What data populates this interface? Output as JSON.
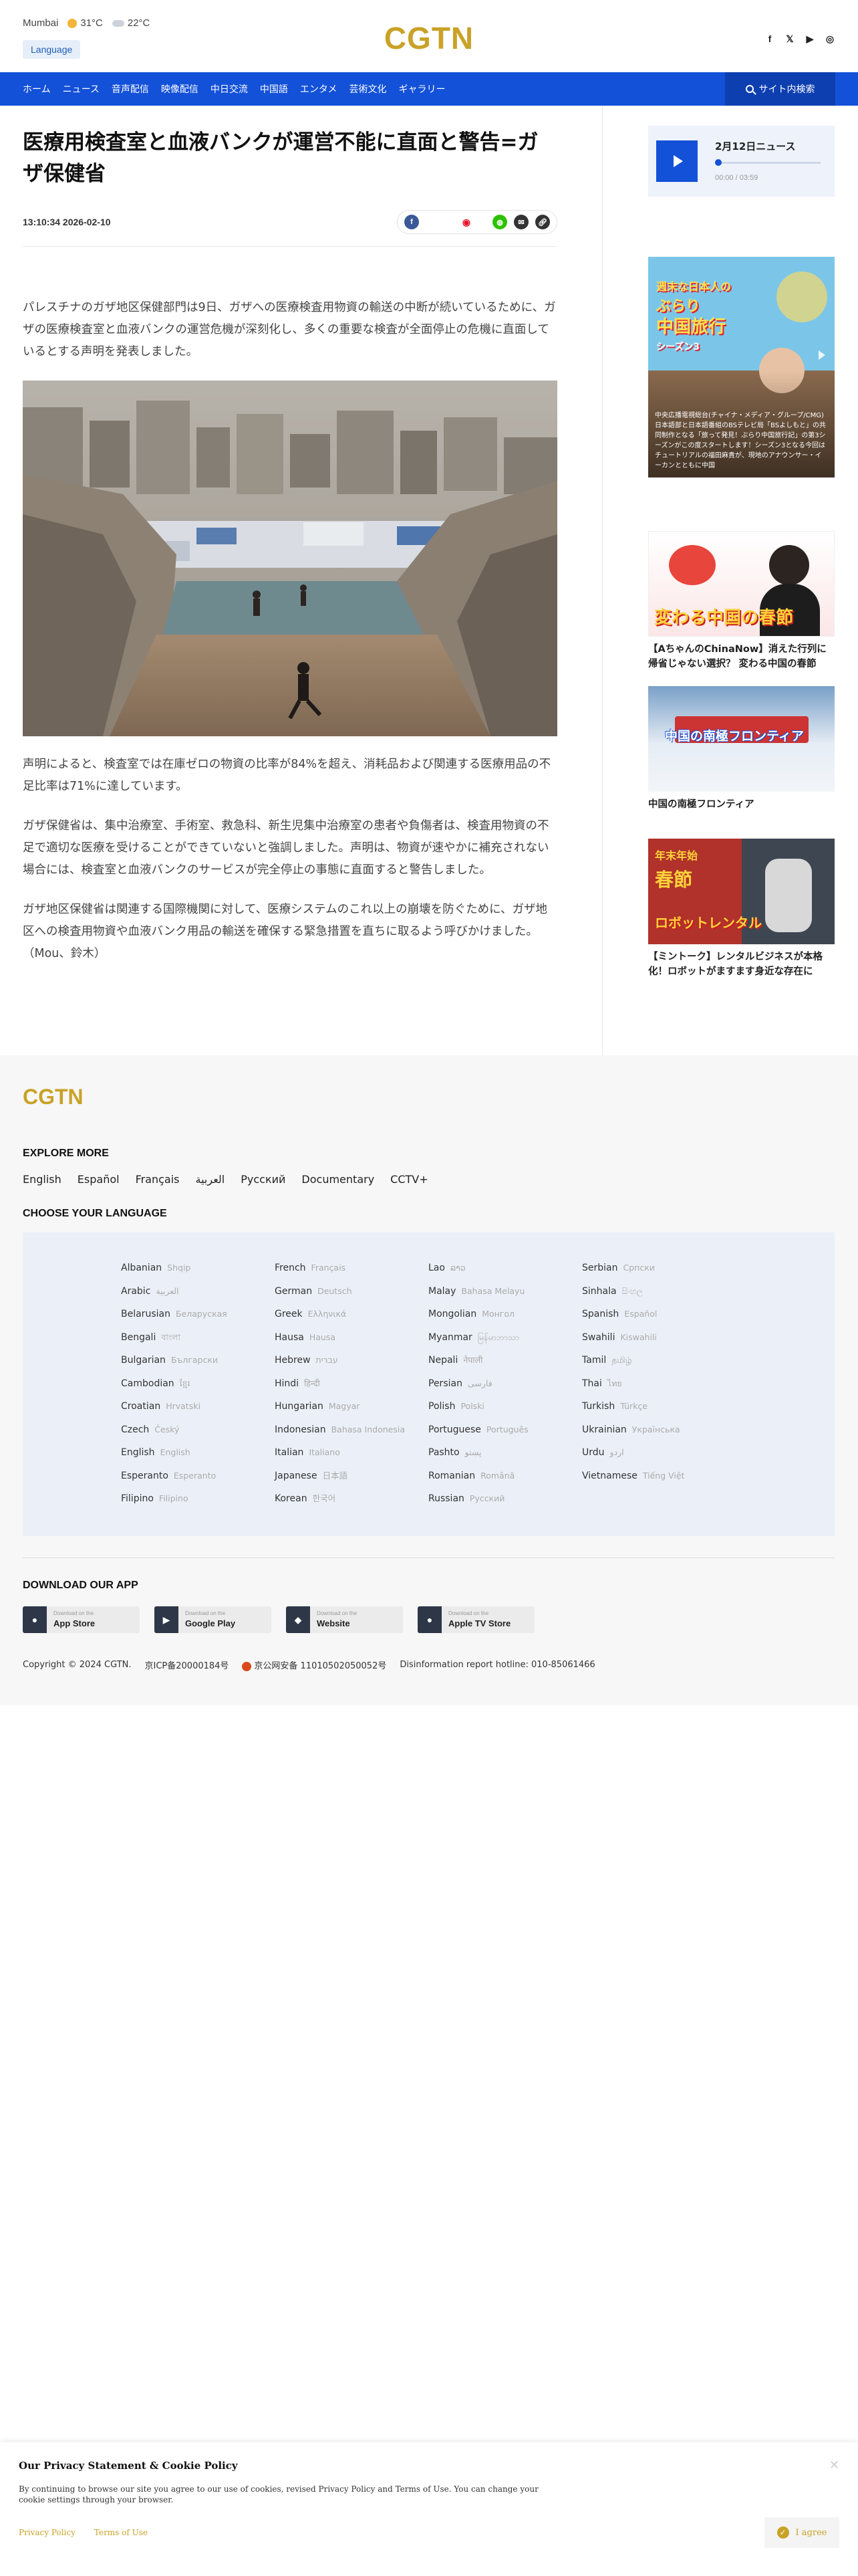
{
  "header": {
    "weather": [
      {
        "city": "Mumbai",
        "temp": "31°C",
        "icon": "sun-icon"
      },
      {
        "temp": "22°C",
        "icon": "cloud-icon"
      }
    ],
    "language_button": "Language",
    "logo": "CGTN",
    "social_icons": [
      "facebook-icon",
      "x-icon",
      "youtube-icon",
      "weibo-icon"
    ]
  },
  "nav": {
    "items": [
      "ホーム",
      "ニュース",
      "音声配信",
      "映像配信",
      "中日交流",
      "中国語",
      "エンタメ",
      "芸術文化",
      "ギャラリー"
    ],
    "search_label": "サイト内検索"
  },
  "article": {
    "headline": "医療用検査室と血液バンクが運営不能に直面と警告=ガザ保健省",
    "datetime": "13:10:34 2026-02-10",
    "share_icons": [
      "facebook-icon",
      "weibo-icon",
      "wechat-icon",
      "email-icon",
      "link-icon"
    ],
    "paragraphs": [
      "パレスチナのガザ地区保健部門は9日、ガザへの医療検査用物資の輸送の中断が続いているために、ガザの医療検査室と血液バンクの運営危機が深刻化し、多くの重要な検査が全面停止の危機に直面しているとする声明を発表しました。",
      "声明によると、検査室では在庫ゼロの物資の比率が84%を超え、消耗品および関連する医療用品の不足比率は71%に達しています。",
      "ガザ保健省は、集中治療室、手術室、救急科、新生児集中治療室の患者や負傷者は、検査用物資の不足で適切な医療を受けることができていないと強調しました。声明は、物資が速やかに補充されない場合には、検査室と血液バンクのサービスが完全停止の事態に直面すると警告しました。",
      "ガザ地区保健省は関連する国際機関に対して、医療システムのこれ以上の崩壊を防ぐために、ガザ地区への検査用物資や血液バンク用品の輸送を確保する緊急措置を直ちに取るよう呼びかけました。（Mou、鈴木）"
    ]
  },
  "sidebar": {
    "audio": {
      "title": "2月12日ニュース",
      "time": "00:00 / 03:59",
      "progress": 0.0
    },
    "video_card": {
      "title_lines": [
        "週末な日本人の",
        "ぶらり",
        "中国旅行",
        "シーズン3"
      ],
      "text": "中央広播電視総台(チャイナ・メディア・グループ/CMG)日本語部と日本語番組のBSテレビ局「BSよしもと」の共同制作となる「旅って発見！ぶらり中国旅行記」の第3シーズンがこの度スタートします！シーズン3となる今回はチュートリアルの福田麻貴が、現地のアナウンサー・イーカンとともに中国"
    },
    "cards": [
      {
        "banner": "変わる中国の春節",
        "title": "【AちゃんのChinaNow】消えた行列に帰省じゃない選択？ 変わる中国の春節"
      },
      {
        "banner": "中国の南極フロンティア",
        "title": "中国の南極フロンティア"
      },
      {
        "banner_top": "年末年始",
        "banner_mid": "春節",
        "banner_bottom": "ロボットレンタル",
        "title": "【ミントーク】レンタルビジネスが本格化！ロボットがますます身近な存在に"
      }
    ]
  },
  "footer": {
    "logo": "CGTN",
    "explore_heading": "EXPLORE MORE",
    "explore_links": [
      "English",
      "Español",
      "Français",
      "العربية",
      "Русский",
      "Documentary",
      "CCTV+"
    ],
    "language_heading": "CHOOSE YOUR LANGUAGE",
    "languages": [
      [
        {
          "en": "Albanian",
          "native": "Shqip"
        },
        {
          "en": "Arabic",
          "native": "العربية"
        },
        {
          "en": "Belarusian",
          "native": "Беларуская"
        },
        {
          "en": "Bengali",
          "native": "বাংলা"
        },
        {
          "en": "Bulgarian",
          "native": "Български"
        },
        {
          "en": "Cambodian",
          "native": "ខ្មែរ"
        },
        {
          "en": "Croatian",
          "native": "Hrvatski"
        },
        {
          "en": "Czech",
          "native": "Český"
        },
        {
          "en": "English",
          "native": "English"
        },
        {
          "en": "Esperanto",
          "native": "Esperanto"
        },
        {
          "en": "Filipino",
          "native": "Filipino"
        }
      ],
      [
        {
          "en": "French",
          "native": "Français"
        },
        {
          "en": "German",
          "native": "Deutsch"
        },
        {
          "en": "Greek",
          "native": "Ελληνικά"
        },
        {
          "en": "Hausa",
          "native": "Hausa"
        },
        {
          "en": "Hebrew",
          "native": "עברית"
        },
        {
          "en": "Hindi",
          "native": "हिन्दी"
        },
        {
          "en": "Hungarian",
          "native": "Magyar"
        },
        {
          "en": "Indonesian",
          "native": "Bahasa Indonesia"
        },
        {
          "en": "Italian",
          "native": "Italiano"
        },
        {
          "en": "Japanese",
          "native": "日本語"
        },
        {
          "en": "Korean",
          "native": "한국어"
        }
      ],
      [
        {
          "en": "Lao",
          "native": "ລາວ"
        },
        {
          "en": "Malay",
          "native": "Bahasa Melayu"
        },
        {
          "en": "Mongolian",
          "native": "Монгол"
        },
        {
          "en": "Myanmar",
          "native": "မြန်မာဘာသာ"
        },
        {
          "en": "Nepali",
          "native": "नेपाली"
        },
        {
          "en": "Persian",
          "native": "فارسی"
        },
        {
          "en": "Polish",
          "native": "Polski"
        },
        {
          "en": "Portuguese",
          "native": "Português"
        },
        {
          "en": "Pashto",
          "native": "پښتو"
        },
        {
          "en": "Romanian",
          "native": "Română"
        },
        {
          "en": "Russian",
          "native": "Русский"
        }
      ],
      [
        {
          "en": "Serbian",
          "native": "Српски"
        },
        {
          "en": "Sinhala",
          "native": "සිංහල"
        },
        {
          "en": "Spanish",
          "native": "Español"
        },
        {
          "en": "Swahili",
          "native": "Kiswahili"
        },
        {
          "en": "Tamil",
          "native": "தமிழ்"
        },
        {
          "en": "Thai",
          "native": "ไทย"
        },
        {
          "en": "Turkish",
          "native": "Türkçe"
        },
        {
          "en": "Ukrainian",
          "native": "Українська"
        },
        {
          "en": "Urdu",
          "native": "اردو"
        },
        {
          "en": "Vietnamese",
          "native": "Tiếng Việt"
        }
      ]
    ],
    "download_heading": "DOWNLOAD OUR APP",
    "apps": [
      {
        "small": "Download on the",
        "big": "App Store",
        "icon": "apple-icon"
      },
      {
        "small": "Download on the",
        "big": "Google Play",
        "icon": "google-play-icon"
      },
      {
        "small": "Download on the",
        "big": "Website",
        "icon": "android-icon"
      },
      {
        "small": "Download on the",
        "big": "Apple TV Store",
        "icon": "apple-icon"
      }
    ],
    "copyright": "Copyright © 2024 CGTN.",
    "icp": "京ICP备20000184号",
    "police": "京公网安备 11010502050052号",
    "hotline": "Disinformation report hotline: 010-85061466"
  },
  "cookie": {
    "title": "Our Privacy Statement & Cookie Policy",
    "text": "By continuing to browse our site you agree to our use of cookies, revised Privacy Policy and Terms of Use. You can change your cookie settings through your browser.",
    "privacy_link": "Privacy Policy",
    "terms_link": "Terms of Use",
    "agree": "I agree"
  },
  "colors": {
    "brand_gold": "#c9a227",
    "nav_blue": "#1351d8"
  }
}
